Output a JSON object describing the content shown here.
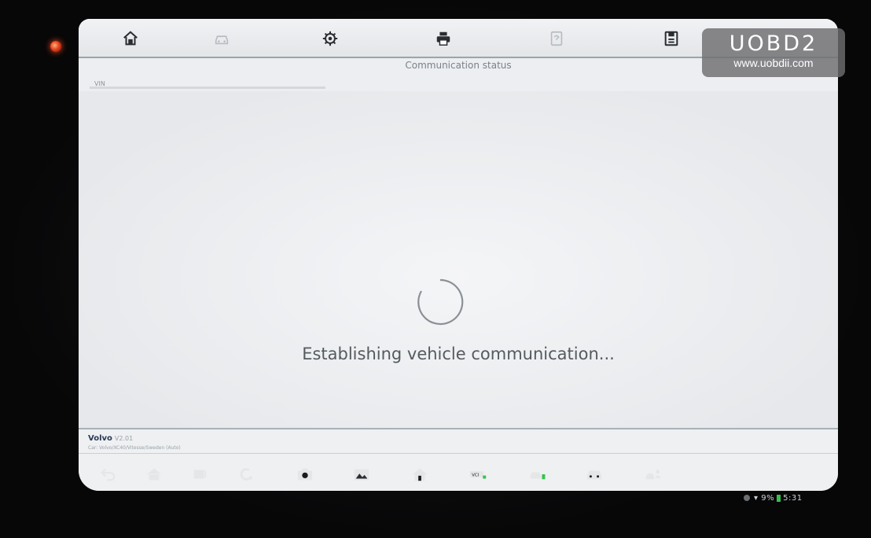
{
  "screen": {
    "status_title": "Communication status",
    "vin_label": "VIN",
    "message": "Establishing vehicle communication...",
    "footer": {
      "make": "Volvo",
      "version": "V2.01",
      "car_path": "Car: Volvo/XC40/Vitesse/Sweden (Auto)"
    }
  },
  "toolbar": {
    "icons": [
      "home-icon",
      "vehicle-swap-icon",
      "settings-icon",
      "print-icon",
      "help-icon",
      "save-icon"
    ]
  },
  "navbar": {
    "icons": [
      "back-icon",
      "android-home-icon",
      "recent-apps-icon",
      "browser-icon",
      "camera-icon",
      "gallery-icon",
      "autel-home-icon",
      "vci-icon",
      "vehicle-shortcut-icon",
      "car-icon",
      "remote-support-icon"
    ]
  },
  "status_bar": {
    "battery": "9%",
    "time": "5:31"
  },
  "watermark": {
    "brand": "UOBD2",
    "url": "www.uobdii.com"
  },
  "colors": {
    "screen_bg": "#eceef1",
    "power_led": "#e8421f",
    "battery": "#36c24a"
  }
}
